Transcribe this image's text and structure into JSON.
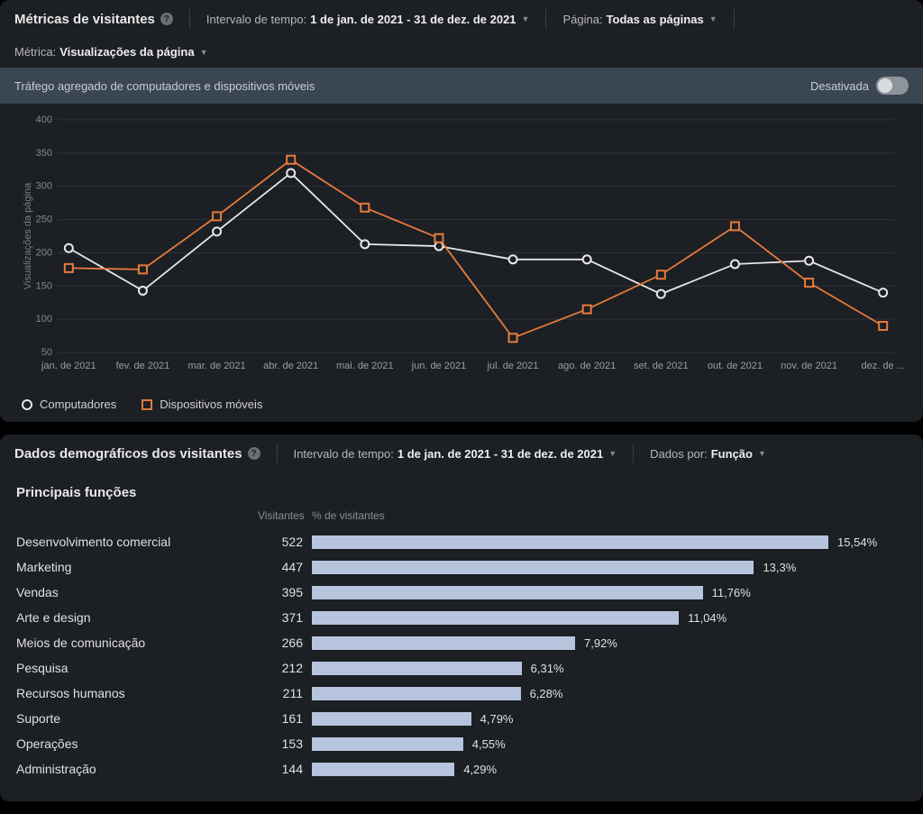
{
  "metrics": {
    "title": "Métricas de visitantes",
    "filters": {
      "time_label": "Intervalo de tempo:",
      "time_value": "1 de jan. de 2021 - 31 de dez. de 2021",
      "page_label": "Página:",
      "page_value": "Todas as páginas",
      "metric_label": "Métrica:",
      "metric_value": "Visualizações da página"
    },
    "aggregate_bar": {
      "label": "Tráfego agregado de computadores e dispositivos móveis",
      "state_label": "Desativada"
    },
    "legend": {
      "desktop": "Computadores",
      "mobile": "Dispositivos móveis"
    }
  },
  "chart_data": {
    "type": "line",
    "title": "",
    "xlabel": "",
    "ylabel": "Visualizações da página",
    "ylim": [
      50,
      400
    ],
    "categories": [
      "jan. de 2021",
      "fev. de 2021",
      "mar. de 2021",
      "abr. de 2021",
      "mai. de 2021",
      "jun. de 2021",
      "jul. de 2021",
      "ago. de 2021",
      "set. de 2021",
      "out. de 2021",
      "nov. de 2021",
      "dez. de ..."
    ],
    "y_ticks": [
      50,
      100,
      150,
      200,
      250,
      300,
      350,
      400
    ],
    "series": [
      {
        "name": "Computadores",
        "marker": "circle",
        "color": "#e7e7e7",
        "values": [
          207,
          143,
          232,
          320,
          213,
          210,
          190,
          190,
          138,
          183,
          188,
          140
        ]
      },
      {
        "name": "Dispositivos móveis",
        "marker": "square",
        "color": "#e67a3c",
        "values": [
          177,
          175,
          255,
          340,
          268,
          222,
          72,
          115,
          167,
          240,
          155,
          90
        ]
      }
    ]
  },
  "demographics": {
    "title": "Dados demográficos dos visitantes",
    "filters": {
      "time_label": "Intervalo de tempo:",
      "time_value": "1 de jan. de 2021 - 31 de dez. de 2021",
      "by_label": "Dados por:",
      "by_value": "Função"
    },
    "subtitle": "Principais funções",
    "columns": {
      "visitors": "Visitantes",
      "pct": "% de visitantes"
    },
    "max_bar": 16,
    "rows": [
      {
        "label": "Desenvolvimento comercial",
        "visitors": 522,
        "pct": "15,54%",
        "pct_num": 15.54
      },
      {
        "label": "Marketing",
        "visitors": 447,
        "pct": "13,3%",
        "pct_num": 13.3
      },
      {
        "label": "Vendas",
        "visitors": 395,
        "pct": "11,76%",
        "pct_num": 11.76
      },
      {
        "label": "Arte e design",
        "visitors": 371,
        "pct": "11,04%",
        "pct_num": 11.04
      },
      {
        "label": "Meios de comunicação",
        "visitors": 266,
        "pct": "7,92%",
        "pct_num": 7.92
      },
      {
        "label": "Pesquisa",
        "visitors": 212,
        "pct": "6,31%",
        "pct_num": 6.31
      },
      {
        "label": "Recursos humanos",
        "visitors": 211,
        "pct": "6,28%",
        "pct_num": 6.28
      },
      {
        "label": "Suporte",
        "visitors": 161,
        "pct": "4,79%",
        "pct_num": 4.79
      },
      {
        "label": "Operações",
        "visitors": 153,
        "pct": "4,55%",
        "pct_num": 4.55
      },
      {
        "label": "Administração",
        "visitors": 144,
        "pct": "4,29%",
        "pct_num": 4.29
      }
    ]
  }
}
